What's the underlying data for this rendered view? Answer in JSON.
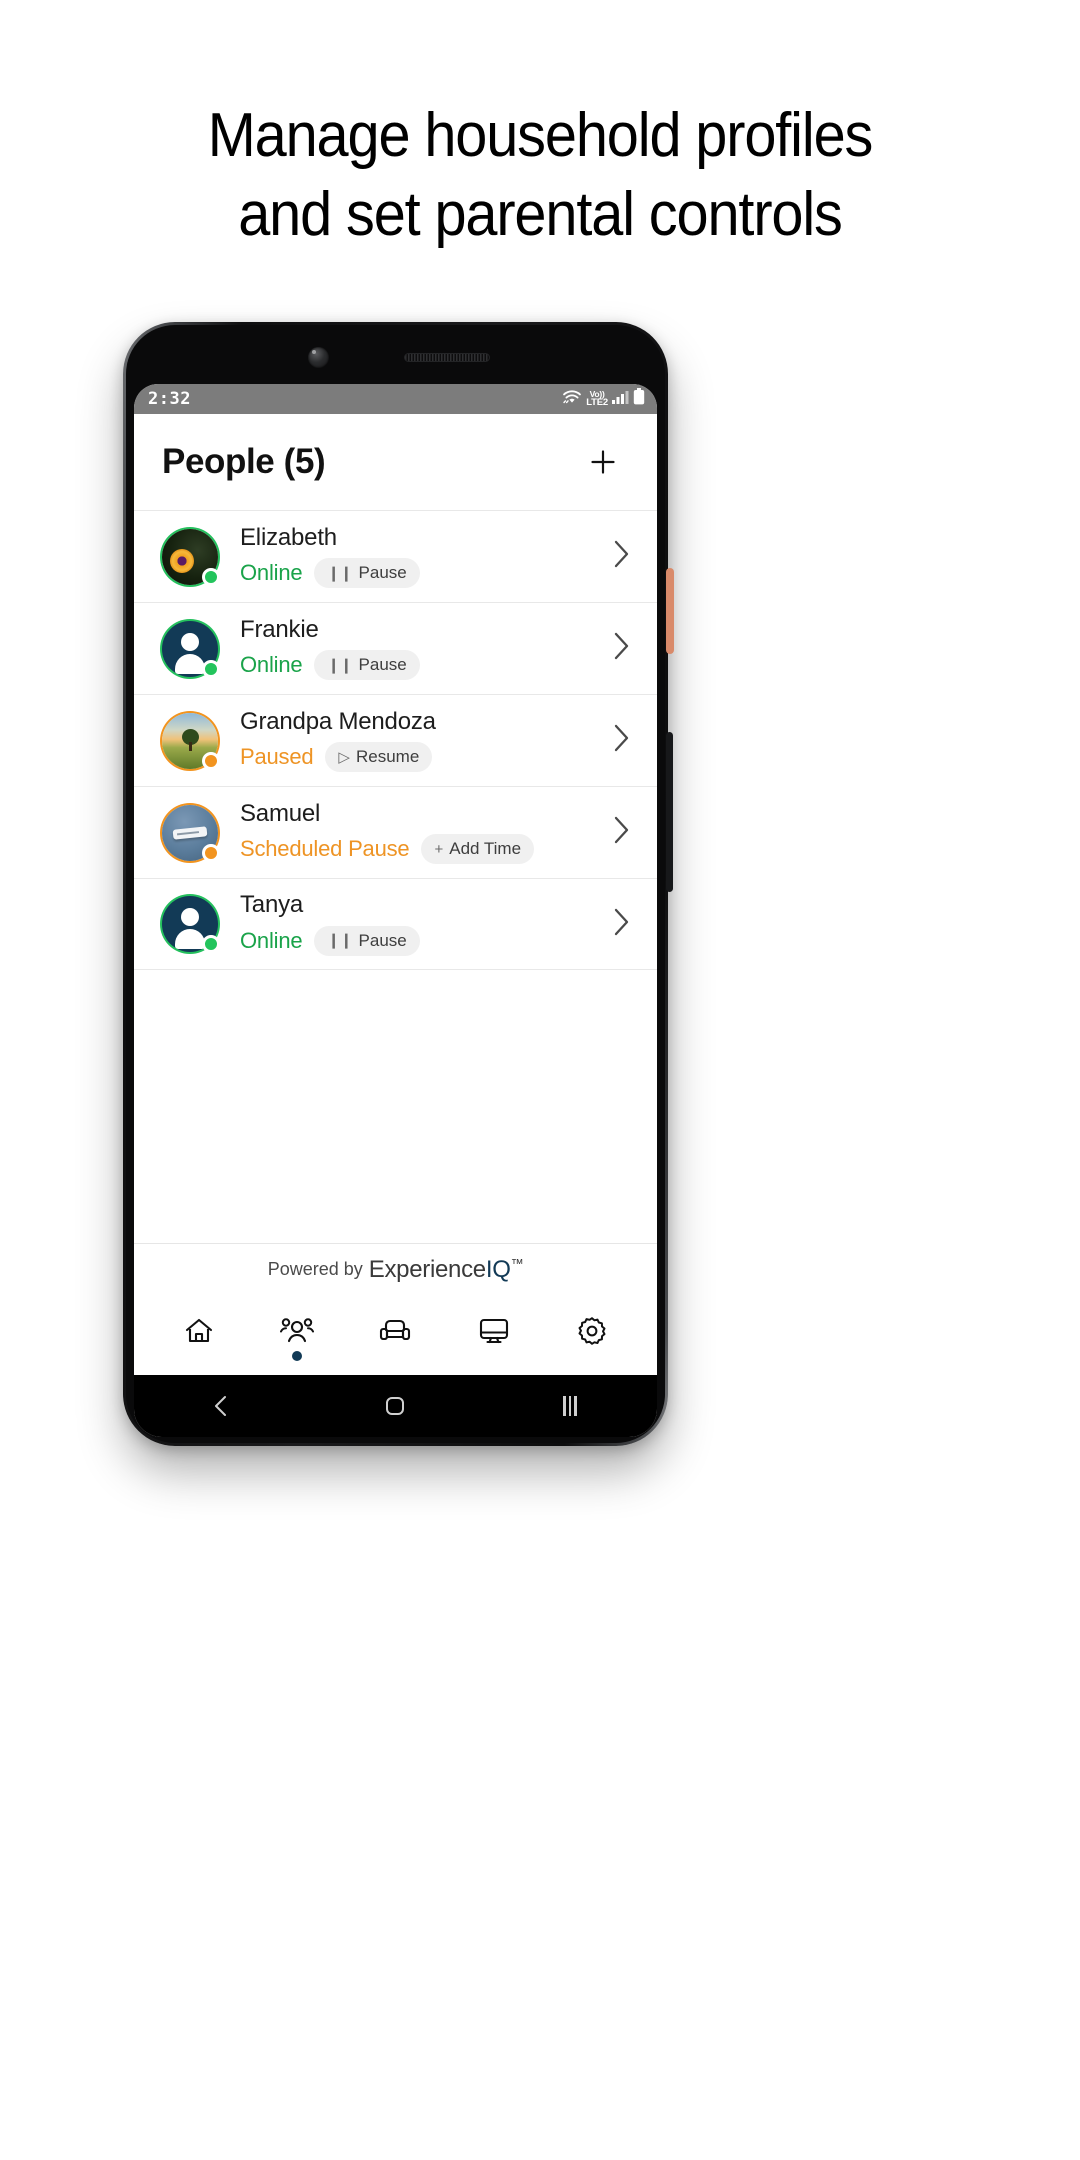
{
  "headline": {
    "line1": "Manage household profiles",
    "line2": "and set parental controls"
  },
  "status_bar": {
    "time": "2:32",
    "wifi_icon": "wifi-icon",
    "volte_top": "Vo))",
    "volte_bottom": "LTE2",
    "signal_icon": "signal-bars-icon",
    "battery_icon": "battery-icon"
  },
  "header": {
    "title": "People (5)",
    "add_icon": "plus-icon"
  },
  "people": [
    {
      "name": "Elizabeth",
      "status": "Online",
      "status_kind": "online",
      "action_label": "Pause",
      "action_icon": "pause-icon",
      "avatar_kind": "photo-flower",
      "chevron_icon": "chevron-right-icon"
    },
    {
      "name": "Frankie",
      "status": "Online",
      "status_kind": "online",
      "action_label": "Pause",
      "action_icon": "pause-icon",
      "avatar_kind": "person-placeholder",
      "chevron_icon": "chevron-right-icon"
    },
    {
      "name": "Grandpa Mendoza",
      "status": "Paused",
      "status_kind": "paused",
      "action_label": "Resume",
      "action_icon": "play-icon",
      "avatar_kind": "photo-field",
      "chevron_icon": "chevron-right-icon"
    },
    {
      "name": "Samuel",
      "status": "Scheduled Pause",
      "status_kind": "paused",
      "action_label": "Add Time",
      "action_icon": "plus-icon",
      "avatar_kind": "photo-device",
      "chevron_icon": "chevron-right-icon"
    },
    {
      "name": "Tanya",
      "status": "Online",
      "status_kind": "online",
      "action_label": "Pause",
      "action_icon": "pause-icon",
      "avatar_kind": "person-placeholder",
      "chevron_icon": "chevron-right-icon"
    }
  ],
  "footer": {
    "powered_label": "Powered by",
    "brand_main": "Experience",
    "brand_accent": "IQ",
    "brand_tm": "™"
  },
  "tabs": [
    {
      "icon": "home-icon",
      "active": false
    },
    {
      "icon": "people-icon",
      "active": true
    },
    {
      "icon": "sofa-icon",
      "active": false
    },
    {
      "icon": "monitor-icon",
      "active": false
    },
    {
      "icon": "gear-icon",
      "active": false
    }
  ],
  "android_nav": {
    "back_icon": "back-chevron-icon",
    "home_icon": "home-square-icon",
    "recents_icon": "recents-icon"
  },
  "colors": {
    "online": "#1aa34a",
    "paused": "#ee9425",
    "brand_navy": "#123a56",
    "chip_bg": "#f0f0f0",
    "status_bar_bg": "#7c7c7c"
  }
}
